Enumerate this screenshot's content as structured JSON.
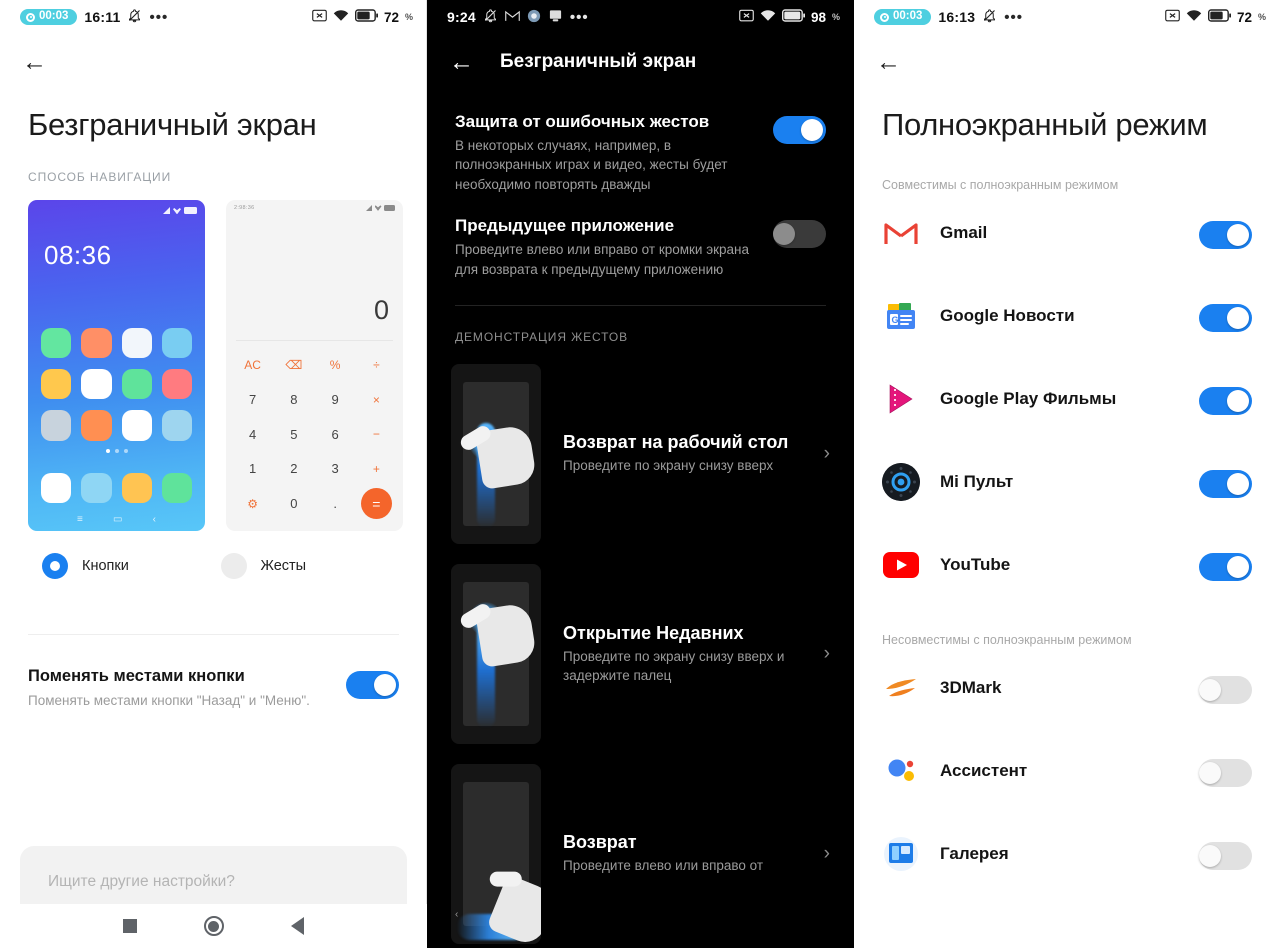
{
  "panel1": {
    "statusbar": {
      "recording": "00:03",
      "time": "16:11",
      "mute_icon": "bell-muted-icon",
      "more_icon": "more-dots-icon",
      "cast_icon": "screen-cast-off-icon",
      "wifi_icon": "wifi-icon",
      "battery_icon": "battery-icon",
      "battery": "72",
      "battery_unit": "%"
    },
    "back_icon": "back-arrow-icon",
    "title": "Безграничный экран",
    "section_caption": "СПОСОБ НАВИГАЦИИ",
    "preview_home": {
      "clock": "08:36",
      "icon_colors": [
        "#63e6a0",
        "#ff8f66",
        "#f2f6fb",
        "#79cdf2",
        "#ffc84d",
        "#ffffff",
        "#5fe39b",
        "#ff7b80",
        "#c8d3dd",
        "#ff8f52",
        "#ffffff",
        "#9ed5ef"
      ],
      "dock_colors": [
        "#ffffff",
        "#8fd6f4",
        "#ffc452",
        "#5fe39b"
      ],
      "nav_hints": [
        "≡",
        "▭",
        "‹"
      ]
    },
    "preview_calc": {
      "status_text": "2:98:36",
      "display": "0",
      "keys": [
        "AC",
        "⌫",
        "%",
        "÷",
        "7",
        "8",
        "9",
        "×",
        "4",
        "5",
        "6",
        "−",
        "1",
        "2",
        "3",
        "+",
        "⚙",
        "0",
        ".",
        "="
      ]
    },
    "radios": [
      {
        "label": "Кнопки",
        "selected": true
      },
      {
        "label": "Жесты",
        "selected": false
      }
    ],
    "swap_setting": {
      "title": "Поменять местами кнопки",
      "subtitle": "Поменять местами кнопки \"Назад\" и \"Меню\".",
      "toggle_on": true
    },
    "search_placeholder": "Ищите другие настройки?",
    "navbar": [
      "recents-square-icon",
      "home-circle-icon",
      "back-triangle-icon"
    ]
  },
  "panel2": {
    "statusbar": {
      "time": "9:24",
      "mute_icon": "bell-muted-icon",
      "gmail_icon": "gmail-icon",
      "app1_icon": "round-app-icon",
      "app2_icon": "screen-app-icon",
      "more_icon": "more-dots-icon",
      "cast_icon": "screen-cast-off-icon",
      "wifi_icon": "wifi-icon",
      "battery_icon": "battery-icon",
      "battery": "98",
      "battery_unit": "%"
    },
    "back_icon": "back-arrow-icon",
    "title": "Безграничный экран",
    "rows": [
      {
        "title": "Защита от ошибочных жестов",
        "subtitle": "В некоторых случаях, например, в полноэкранных играх и видео, жесты будет необходимо повторять дважды",
        "toggle_on": true
      },
      {
        "title": "Предыдущее приложение",
        "subtitle": "Проведите влево или вправо от кромки экрана для возврата к предыдущему приложению",
        "toggle_on": false
      }
    ],
    "section_caption": "ДЕМОНСТРАЦИЯ ЖЕСТОВ",
    "gestures": [
      {
        "title": "Возврат на рабочий стол",
        "subtitle": "Проведите по экрану снизу вверх",
        "chevron": "chevron-right-icon"
      },
      {
        "title": "Открытие Недавних",
        "subtitle": "Проведите по экрану снизу вверх и задержите палец",
        "chevron": "chevron-right-icon"
      },
      {
        "title": "Возврат",
        "subtitle": "Проведите влево или вправо от",
        "chevron": "chevron-right-icon"
      }
    ]
  },
  "panel3": {
    "statusbar": {
      "recording": "00:03",
      "time": "16:13",
      "mute_icon": "bell-muted-icon",
      "more_icon": "more-dots-icon",
      "cast_icon": "screen-cast-off-icon",
      "wifi_icon": "wifi-icon",
      "battery_icon": "battery-icon",
      "battery": "72",
      "battery_unit": "%"
    },
    "back_icon": "back-arrow-icon",
    "title": "Полноэкранный режим",
    "compatible_caption": "Совместимы с полноэкранным режимом",
    "incompatible_caption": "Несовместимы с полноэкранным режимом",
    "compatible_apps": [
      {
        "name": "Gmail",
        "icon": "gmail-icon",
        "toggle_on": true
      },
      {
        "name": "Google Новости",
        "icon": "google-news-icon",
        "toggle_on": true
      },
      {
        "name": "Google Play Фильмы",
        "icon": "google-play-movies-icon",
        "toggle_on": true
      },
      {
        "name": "Mi Пульт",
        "icon": "mi-remote-icon",
        "toggle_on": true
      },
      {
        "name": "YouTube",
        "icon": "youtube-icon",
        "toggle_on": true
      }
    ],
    "incompatible_apps": [
      {
        "name": "3DMark",
        "icon": "3dmark-icon",
        "toggle_on": false
      },
      {
        "name": "Ассистент",
        "icon": "google-assistant-icon",
        "toggle_on": false
      },
      {
        "name": "Галерея",
        "icon": "gallery-icon",
        "toggle_on": false
      }
    ]
  },
  "colors": {
    "accent_blue": "#1a80f0",
    "recording_teal": "#4ecfe0",
    "calc_orange": "#f4652b",
    "toggle_off_light": "#e1e1e1",
    "toggle_off_dark": "#3a3a3a"
  }
}
